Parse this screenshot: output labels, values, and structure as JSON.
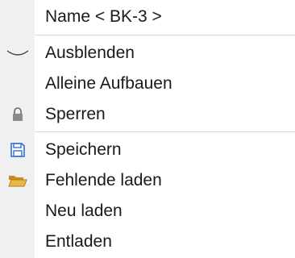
{
  "menu": {
    "header": {
      "label": "Name < BK-3 >"
    },
    "items": [
      {
        "label": "Ausblenden",
        "icon": "eye-closed-icon"
      },
      {
        "label": "Alleine Aufbauen",
        "icon": ""
      },
      {
        "label": "Sperren",
        "icon": "lock-icon"
      },
      {
        "label": "Speichern",
        "icon": "save-disk-icon"
      },
      {
        "label": "Fehlende laden",
        "icon": "open-folder-icon"
      },
      {
        "label": "Neu laden",
        "icon": ""
      },
      {
        "label": "Entladen",
        "icon": ""
      }
    ]
  },
  "colors": {
    "gutter": "#f0f0f0",
    "separator": "#d8d8d8",
    "text": "#1a1a1a",
    "save_icon": "#2f6fcf",
    "folder_icon": "#e0a83a"
  }
}
